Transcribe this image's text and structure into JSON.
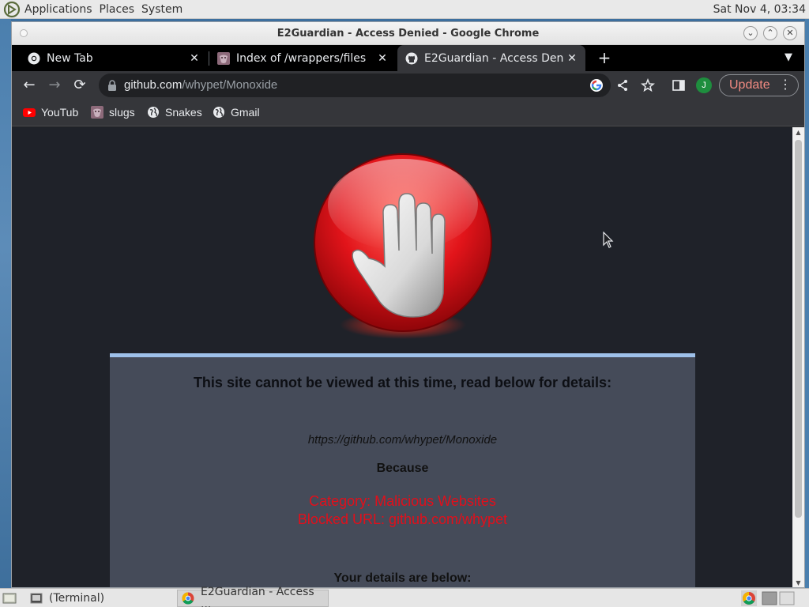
{
  "desktop": {
    "menus": [
      "Applications",
      "Places",
      "System"
    ],
    "clock": "Sat Nov  4, 03:34"
  },
  "window": {
    "title": "E2Guardian - Access Denied - Google Chrome"
  },
  "tabs": [
    {
      "label": "New Tab",
      "icon": "chrome-icon"
    },
    {
      "label": "Index of /wrappers/files",
      "icon": "slug-favicon"
    },
    {
      "label": "E2Guardian - Access Denied",
      "icon": "github-icon",
      "active": true
    }
  ],
  "omnibox": {
    "host": "github.com",
    "path": "/whypet/Monoxide"
  },
  "toolbar": {
    "profile_initial": "J",
    "update_label": "Update"
  },
  "bookmarks": [
    {
      "label": "YouTub",
      "icon": "youtube-icon"
    },
    {
      "label": "slugs",
      "icon": "slug-favicon"
    },
    {
      "label": "Snakes",
      "icon": "globe-icon"
    },
    {
      "label": "Gmail",
      "icon": "globe-icon"
    }
  ],
  "page": {
    "heading": "This site cannot be viewed at this time, read below for details:",
    "blocked_url": "https://github.com/whypet/Monoxide",
    "because": "Because",
    "category": "Category: Malicious Websites",
    "blocked_reason": "Blocked URL: github.com/whypet",
    "details_heading": "Your details are below:"
  },
  "taskbar": {
    "items": [
      {
        "label": "(Terminal)"
      },
      {
        "label": "E2Guardian - Access ..."
      }
    ]
  },
  "colors": {
    "accent_red": "#e10f1b",
    "panel_bg": "#454b59",
    "panel_border": "#9ec1ea",
    "page_bg": "#1f2229"
  }
}
